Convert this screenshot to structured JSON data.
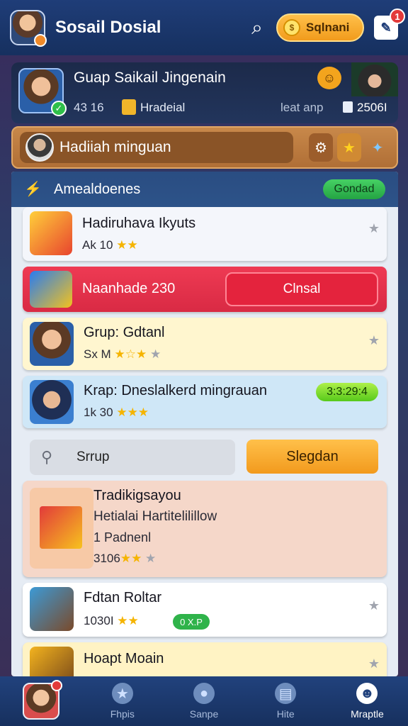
{
  "header": {
    "title": "Sosail Dosial",
    "coin_label": "Sqlnani",
    "notification_count": "1"
  },
  "group": {
    "name": "Guap Saikail Jingenain",
    "members": "43 16",
    "status": "Hradeial",
    "last": "leat anp",
    "count": "2506I"
  },
  "weekly": {
    "label": "Hadiiah minguan"
  },
  "section": {
    "title": "Amealdoenes",
    "button": "Gondad"
  },
  "cards": {
    "c1": {
      "title": "Hadiruhava Ikyuts",
      "meta": "Ak 10"
    },
    "c2": {
      "title": "Naanhade 230",
      "button": "Clnsal"
    },
    "c3": {
      "title": "Grup: Gdtanl",
      "meta": "Sx M"
    },
    "c4": {
      "title": "Krap: Dneslalkerd mingrauan",
      "timer": "3:3:29:4",
      "meta": "1k 30"
    },
    "c5": {
      "search_label": "Srrup",
      "button": "Slegdan"
    },
    "c6": {
      "title": "Tradikigsayou",
      "subtitle": "Hetialai Hartitelilillow",
      "line3": "1 Padnenl",
      "meta": "3106"
    },
    "c7": {
      "title": "Fdtan Roltar",
      "meta": "1030I",
      "badge": "0 X.P"
    },
    "c8": {
      "title": "Hoapt Moain"
    }
  },
  "nav": {
    "items": [
      "Fhpis",
      "Sanpe",
      "Hite",
      "Mraptle"
    ]
  },
  "colors": {
    "primary": "#1f3d78",
    "accent": "#f19b1c",
    "danger": "#e6334a",
    "success": "#2fbf4a"
  }
}
